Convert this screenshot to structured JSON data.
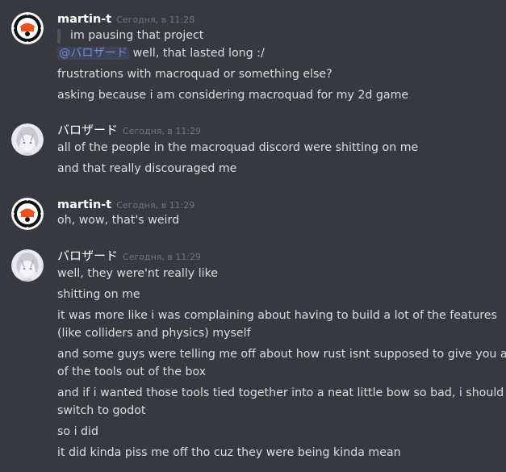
{
  "messages": {
    "g1": {
      "author": "martin-t",
      "timestamp": "Сегодня, в 11:28",
      "quote": "im pausing that project",
      "mention": "@バロザード",
      "reply": " well, that lasted long :/",
      "lines": [
        "frustrations with macroquad or something else?",
        "asking because i am considering macroquad for my 2d game"
      ]
    },
    "g2": {
      "author": "バロザード",
      "timestamp": "Сегодня, в 11:29",
      "lines": [
        "all of the people in the macroquad discord were shitting on me",
        "and that really discouraged me"
      ]
    },
    "g3": {
      "author": "martin-t",
      "timestamp": "Сегодня, в 11:29",
      "lines": [
        "oh, wow, that's weird"
      ]
    },
    "g4": {
      "author": "バロザード",
      "timestamp": "Сегодня, в 11:29",
      "lines": [
        "well, they were'nt really like",
        "shitting on me",
        "it was more like i was complaining about having to build a lot of the features",
        "(like colliders and physics) myself",
        "and some guys were telling me off about how rust isnt supposed to give you all",
        "of the tools out of the box",
        "and if i wanted those tools tied together into a neat little bow so bad, i should",
        "switch to godot",
        "so i did",
        "it did kinda piss me off tho cuz they were being kinda mean"
      ]
    }
  },
  "colors": {
    "background": "#36393f",
    "text": "#dcddde",
    "username": "#ffffff",
    "timestamp": "#72767d",
    "mention": "#7289da",
    "quote_bar": "#4f545c"
  }
}
